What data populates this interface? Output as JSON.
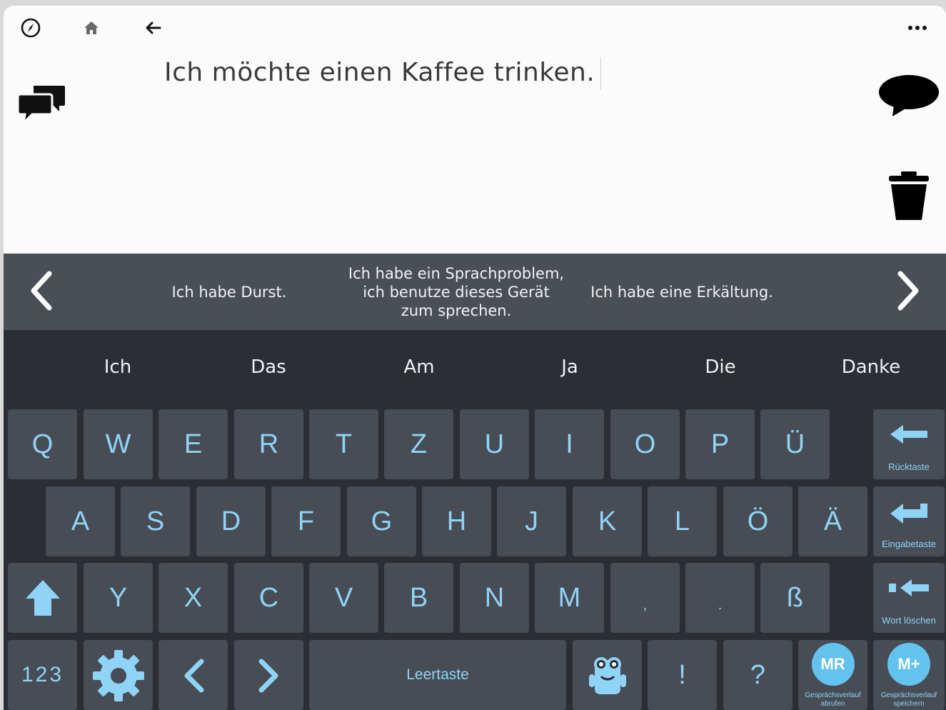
{
  "top_bar": {
    "compass_icon": "compass-icon",
    "home_icon": "home-icon",
    "back_icon": "back-arrow-icon",
    "more_icon": "more-icon"
  },
  "message": {
    "text": "Ich möchte einen Kaffee trinken."
  },
  "phrases": {
    "items": [
      "Ich habe Durst.",
      "Ich habe ein Sprachproblem, ich benutze dieses Gerät zum sprechen.",
      "Ich habe eine Erkältung."
    ]
  },
  "predictions": [
    "Ich",
    "Das",
    "Am",
    "Ja",
    "Die",
    "Danke"
  ],
  "keys": {
    "row1": [
      "Q",
      "W",
      "E",
      "R",
      "T",
      "Z",
      "U",
      "I",
      "O",
      "P",
      "Ü"
    ],
    "row2": [
      "A",
      "S",
      "D",
      "F",
      "G",
      "H",
      "J",
      "K",
      "L",
      "Ö",
      "Ä"
    ],
    "row3": [
      "Y",
      "X",
      "C",
      "V",
      "B",
      "N",
      "M",
      ",",
      ".",
      "ß"
    ],
    "numbers": "123",
    "space": "Leertaste",
    "excl": "!",
    "quest": "?"
  },
  "function_keys": {
    "backspace": "Rücktaste",
    "enter": "Eingabetaste",
    "delete_word": "Wort löschen",
    "mr_badge": "MR",
    "mr_label": "Gesprächsverlauf abrufen",
    "mplus_badge": "M+",
    "mplus_label": "Gesprächsverlauf speichern"
  },
  "colors": {
    "key_text": "#8fd3f6",
    "key_bg": "#474c55",
    "keyboard_bg": "#2b2f35",
    "phrase_bar_bg": "#4a4f56",
    "badge": "#63c3ee"
  }
}
